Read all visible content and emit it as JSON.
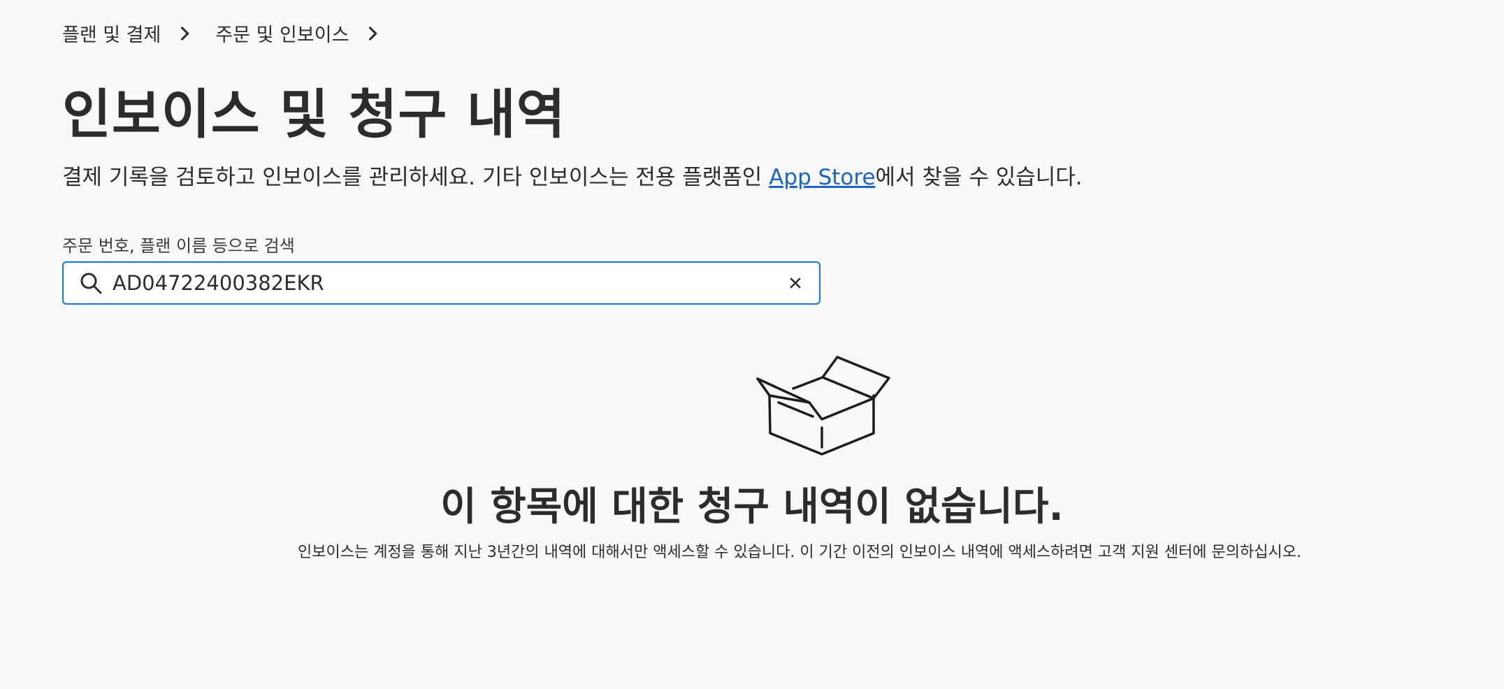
{
  "breadcrumb": {
    "items": [
      {
        "label": "플랜 및 결제"
      },
      {
        "label": "주문 및 인보이스"
      }
    ]
  },
  "page": {
    "title": "인보이스 및 청구 내역",
    "subtitle_before": "결제 기록을 검토하고 인보이스를 관리하세요. 기타 인보이스는 전용 플랫폼인 ",
    "subtitle_link": "App Store",
    "subtitle_after": "에서 찾을 수 있습니다."
  },
  "search": {
    "label": "주문 번호, 플랜 이름 등으로 검색",
    "value": "AD04722400382EKR",
    "icon": "search-icon",
    "clear_icon": "close-icon"
  },
  "empty_state": {
    "icon": "open-box-icon",
    "title": "이 항목에 대한 청구 내역이 없습니다.",
    "description": "인보이스는 계정을 통해 지난 3년간의 내역에 대해서만 액세스할 수 있습니다. 이 기간 이전의 인보이스 내역에 액세스하려면 고객 지원 센터에 문의하십시오."
  },
  "colors": {
    "accent": "#1473e6",
    "link": "#1a64c8",
    "background": "#f8f8f8",
    "text": "#2c2c2c"
  }
}
